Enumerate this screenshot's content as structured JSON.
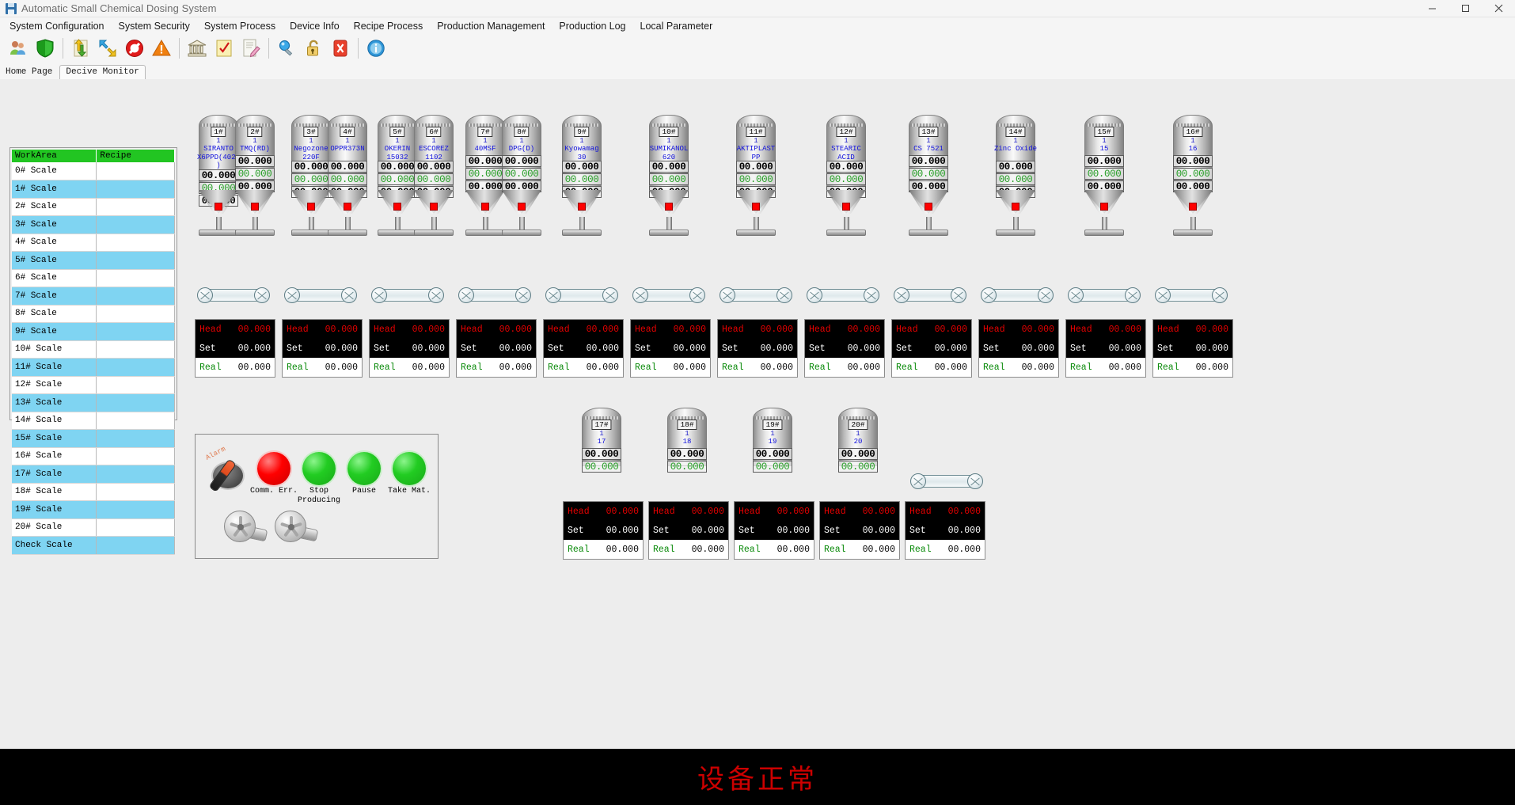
{
  "window": {
    "title": "Automatic Small Chemical Dosing System",
    "app_icon": "disk-icon",
    "minimize": "minimize-icon",
    "maximize": "maximize-icon",
    "close": "close-icon"
  },
  "menu": {
    "items": [
      {
        "label": "System Configuration"
      },
      {
        "label": "System Security"
      },
      {
        "label": "System Process"
      },
      {
        "label": "Device Info"
      },
      {
        "label": "Recipe Process"
      },
      {
        "label": "Production Management"
      },
      {
        "label": "Production Log"
      },
      {
        "label": "Local Parameter"
      }
    ]
  },
  "toolbar": {
    "buttons": [
      {
        "icon": "users-icon",
        "tip": "Users"
      },
      {
        "icon": "shield-icon",
        "tip": "Security"
      },
      {
        "sep": true
      },
      {
        "icon": "upload-download-icon",
        "tip": "Transfer"
      },
      {
        "icon": "arrows-diagonal-icon",
        "tip": "Move"
      },
      {
        "icon": "forbidden-icon",
        "tip": "Stop"
      },
      {
        "icon": "warning-icon",
        "tip": "Alarm"
      },
      {
        "sep": true
      },
      {
        "icon": "bank-icon",
        "tip": "Warehouse"
      },
      {
        "icon": "checklist-icon",
        "tip": "Recipe"
      },
      {
        "icon": "edit-document-icon",
        "tip": "Edit"
      },
      {
        "sep": true
      },
      {
        "icon": "search-icon",
        "tip": "Search"
      },
      {
        "icon": "lock-icon",
        "tip": "Lock"
      },
      {
        "icon": "close-red-icon",
        "tip": "Close"
      },
      {
        "sep": true
      },
      {
        "icon": "info-icon",
        "tip": "About"
      }
    ]
  },
  "tabs": {
    "items": [
      {
        "label": "Home Page",
        "active": false
      },
      {
        "label": "Decive Monitor",
        "active": true
      }
    ]
  },
  "sidebar": {
    "columns": [
      "WorkArea",
      "Recipe"
    ],
    "rows": [
      {
        "area": "0# Scale",
        "recipe": ""
      },
      {
        "area": "1# Scale",
        "recipe": ""
      },
      {
        "area": "2# Scale",
        "recipe": ""
      },
      {
        "area": "3# Scale",
        "recipe": ""
      },
      {
        "area": "4# Scale",
        "recipe": ""
      },
      {
        "area": "5# Scale",
        "recipe": ""
      },
      {
        "area": "6# Scale",
        "recipe": ""
      },
      {
        "area": "7# Scale",
        "recipe": ""
      },
      {
        "area": "8# Scale",
        "recipe": ""
      },
      {
        "area": "9# Scale",
        "recipe": ""
      },
      {
        "area": "10# Scale",
        "recipe": ""
      },
      {
        "area": "11# Scale",
        "recipe": ""
      },
      {
        "area": "12# Scale",
        "recipe": ""
      },
      {
        "area": "13# Scale",
        "recipe": ""
      },
      {
        "area": "14# Scale",
        "recipe": ""
      },
      {
        "area": "15# Scale",
        "recipe": ""
      },
      {
        "area": "16# Scale",
        "recipe": ""
      },
      {
        "area": "17# Scale",
        "recipe": ""
      },
      {
        "area": "18# Scale",
        "recipe": ""
      },
      {
        "area": "19# Scale",
        "recipe": ""
      },
      {
        "area": "20# Scale",
        "recipe": ""
      },
      {
        "area": "Check Scale",
        "recipe": ""
      }
    ]
  },
  "silos_top": [
    {
      "tag": "1#",
      "idx": "1",
      "material": "SIRANTO X6PPD(4020)",
      "val_big": "00.000",
      "val_green": "00.000",
      "val_big2": "00.000"
    },
    {
      "tag": "2#",
      "idx": "1",
      "material": "TMQ(RD)",
      "val_big": "00.000",
      "val_green": "00.000",
      "val_big2": "00.000"
    },
    {
      "tag": "3#",
      "idx": "1",
      "material": "Negozone 220F",
      "val_big": "00.000",
      "val_green": "00.000",
      "val_big2": "00.000"
    },
    {
      "tag": "4#",
      "idx": "1",
      "material": "OPPR373N",
      "val_big": "00.000",
      "val_green": "00.000",
      "val_big2": "00.000"
    },
    {
      "tag": "5#",
      "idx": "1",
      "material": "OKERIN 15032",
      "val_big": "00.000",
      "val_green": "00.000",
      "val_big2": "00.000"
    },
    {
      "tag": "6#",
      "idx": "1",
      "material": "ESCOREZ 1102",
      "val_big": "00.000",
      "val_green": "00.000",
      "val_big2": "00.000"
    },
    {
      "tag": "7#",
      "idx": "1",
      "material": "40MSF",
      "val_big": "00.000",
      "val_green": "00.000",
      "val_big2": "00.000"
    },
    {
      "tag": "8#",
      "idx": "1",
      "material": "DPG(D)",
      "val_big": "00.000",
      "val_green": "00.000",
      "val_big2": "00.000"
    },
    {
      "tag": "9#",
      "idx": "1",
      "material": "Kyowamag 30",
      "val_big": "00.000",
      "val_green": "00.000",
      "val_big2": "00.000"
    },
    {
      "tag": "10#",
      "idx": "1",
      "material": "SUMIKANOL 620",
      "val_big": "00.000",
      "val_green": "00.000",
      "val_big2": "00.000"
    },
    {
      "tag": "11#",
      "idx": "1",
      "material": "AKTIPLAST PP",
      "val_big": "00.000",
      "val_green": "00.000",
      "val_big2": "00.000"
    },
    {
      "tag": "12#",
      "idx": "1",
      "material": "STEARIC ACID",
      "val_big": "00.000",
      "val_green": "00.000",
      "val_big2": "00.000"
    },
    {
      "tag": "13#",
      "idx": "1",
      "material": "CS 7521",
      "val_big": "00.000",
      "val_green": "00.000",
      "val_big2": "00.000"
    },
    {
      "tag": "14#",
      "idx": "1",
      "material": "Zinc Oxide",
      "val_big": "00.000",
      "val_green": "00.000",
      "val_big2": "00.000"
    },
    {
      "tag": "15#",
      "idx": "1",
      "material": "15",
      "val_big": "00.000",
      "val_green": "00.000",
      "val_big2": "00.000"
    },
    {
      "tag": "16#",
      "idx": "1",
      "material": "16",
      "val_big": "00.000",
      "val_green": "00.000",
      "val_big2": "00.000"
    }
  ],
  "silos_bottom": [
    {
      "tag": "17#",
      "idx": "1",
      "material": "17",
      "val_big": "00.000",
      "val_green": "00.000"
    },
    {
      "tag": "18#",
      "idx": "1",
      "material": "18",
      "val_big": "00.000",
      "val_green": "00.000"
    },
    {
      "tag": "19#",
      "idx": "1",
      "material": "19",
      "val_big": "00.000",
      "val_green": "00.000"
    },
    {
      "tag": "20#",
      "idx": "1",
      "material": "20",
      "val_big": "00.000",
      "val_green": "00.000"
    }
  ],
  "weight_labels": {
    "head": "Head",
    "set": "Set",
    "real": "Real"
  },
  "weight_panels_top": [
    {
      "head": "00.000",
      "set": "00.000",
      "real": "00.000"
    },
    {
      "head": "00.000",
      "set": "00.000",
      "real": "00.000"
    },
    {
      "head": "00.000",
      "set": "00.000",
      "real": "00.000"
    },
    {
      "head": "00.000",
      "set": "00.000",
      "real": "00.000"
    },
    {
      "head": "00.000",
      "set": "00.000",
      "real": "00.000"
    },
    {
      "head": "00.000",
      "set": "00.000",
      "real": "00.000"
    },
    {
      "head": "00.000",
      "set": "00.000",
      "real": "00.000"
    },
    {
      "head": "00.000",
      "set": "00.000",
      "real": "00.000"
    },
    {
      "head": "00.000",
      "set": "00.000",
      "real": "00.000"
    },
    {
      "head": "00.000",
      "set": "00.000",
      "real": "00.000"
    },
    {
      "head": "00.000",
      "set": "00.000",
      "real": "00.000"
    },
    {
      "head": "00.000",
      "set": "00.000",
      "real": "00.000"
    }
  ],
  "weight_panels_bottom": [
    {
      "head": "00.000",
      "set": "00.000",
      "real": "00.000"
    },
    {
      "head": "00.000",
      "set": "00.000",
      "real": "00.000"
    },
    {
      "head": "00.000",
      "set": "00.000",
      "real": "00.000"
    },
    {
      "head": "00.000",
      "set": "00.000",
      "real": "00.000"
    },
    {
      "head": "00.000",
      "set": "00.000",
      "real": "00.000"
    }
  ],
  "control_panel": {
    "alarm_switch_label": "Alarm",
    "lamps": [
      {
        "color": "#ff0000",
        "caption": "Comm. Err.",
        "state": "red"
      },
      {
        "color": "#22cc22",
        "caption": "Stop Producing",
        "state": "green"
      },
      {
        "color": "#22cc22",
        "caption": "Pause",
        "state": "green"
      },
      {
        "color": "#22cc22",
        "caption": "Take Mat.",
        "state": "green"
      }
    ],
    "fans": [
      {
        "name": "fan-1"
      },
      {
        "name": "fan-2"
      }
    ]
  },
  "status": {
    "text": "设备正常",
    "color": "#cc0000"
  }
}
